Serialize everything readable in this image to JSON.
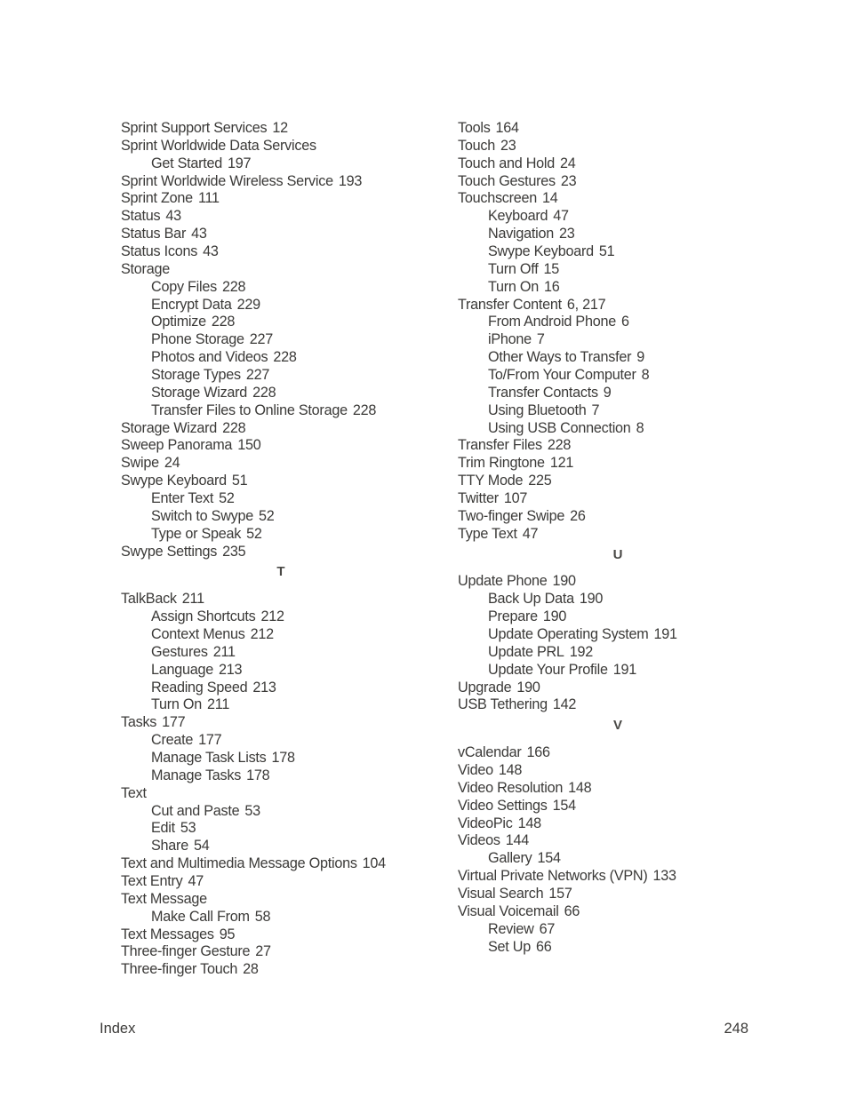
{
  "columns": [
    {
      "blocks": [
        {
          "type": "entries",
          "entries": [
            {
              "term": "Sprint Support Services",
              "pages": "12",
              "level": 0
            },
            {
              "term": "Sprint Worldwide Data Services",
              "pages": "",
              "level": 0
            },
            {
              "term": "Get Started",
              "pages": "197",
              "level": 1
            },
            {
              "term": "Sprint Worldwide Wireless Service",
              "pages": "193",
              "level": 0
            },
            {
              "term": "Sprint Zone",
              "pages": "111",
              "level": 0
            },
            {
              "term": "Status",
              "pages": "43",
              "level": 0
            },
            {
              "term": "Status Bar",
              "pages": "43",
              "level": 0
            },
            {
              "term": "Status Icons",
              "pages": "43",
              "level": 0
            },
            {
              "term": "Storage",
              "pages": "",
              "level": 0
            },
            {
              "term": "Copy Files",
              "pages": "228",
              "level": 1
            },
            {
              "term": "Encrypt Data",
              "pages": "229",
              "level": 1
            },
            {
              "term": "Optimize",
              "pages": "228",
              "level": 1
            },
            {
              "term": "Phone Storage",
              "pages": "227",
              "level": 1
            },
            {
              "term": "Photos and Videos",
              "pages": "228",
              "level": 1
            },
            {
              "term": "Storage Types",
              "pages": "227",
              "level": 1
            },
            {
              "term": "Storage Wizard",
              "pages": "228",
              "level": 1
            },
            {
              "term": "Transfer Files to Online Storage",
              "pages": "228",
              "level": 1
            },
            {
              "term": "Storage Wizard",
              "pages": "228",
              "level": 0
            },
            {
              "term": "Sweep Panorama",
              "pages": "150",
              "level": 0
            },
            {
              "term": "Swipe",
              "pages": "24",
              "level": 0
            },
            {
              "term": "Swype Keyboard",
              "pages": "51",
              "level": 0
            },
            {
              "term": "Enter Text",
              "pages": "52",
              "level": 1
            },
            {
              "term": "Switch to Swype",
              "pages": "52",
              "level": 1
            },
            {
              "term": "Type or Speak",
              "pages": "52",
              "level": 1
            },
            {
              "term": "Swype Settings",
              "pages": "235",
              "level": 0
            }
          ]
        },
        {
          "type": "letter",
          "letter": "T"
        },
        {
          "type": "entries",
          "entries": [
            {
              "term": "TalkBack",
              "pages": "211",
              "level": 0
            },
            {
              "term": "Assign Shortcuts",
              "pages": "212",
              "level": 1
            },
            {
              "term": "Context Menus",
              "pages": "212",
              "level": 1
            },
            {
              "term": "Gestures",
              "pages": "211",
              "level": 1
            },
            {
              "term": "Language",
              "pages": "213",
              "level": 1
            },
            {
              "term": "Reading Speed",
              "pages": "213",
              "level": 1
            },
            {
              "term": "Turn On",
              "pages": "211",
              "level": 1
            },
            {
              "term": "Tasks",
              "pages": "177",
              "level": 0
            },
            {
              "term": "Create",
              "pages": "177",
              "level": 1
            },
            {
              "term": "Manage Task Lists",
              "pages": "178",
              "level": 1
            },
            {
              "term": "Manage Tasks",
              "pages": "178",
              "level": 1
            },
            {
              "term": "Text",
              "pages": "",
              "level": 0
            },
            {
              "term": "Cut and Paste",
              "pages": "53",
              "level": 1
            },
            {
              "term": "Edit",
              "pages": "53",
              "level": 1
            },
            {
              "term": "Share",
              "pages": "54",
              "level": 1
            },
            {
              "term": "Text and Multimedia Message Options",
              "pages": "104",
              "level": 0
            },
            {
              "term": "Text Entry",
              "pages": "47",
              "level": 0
            },
            {
              "term": "Text Message",
              "pages": "",
              "level": 0
            },
            {
              "term": "Make Call From",
              "pages": "58",
              "level": 1
            },
            {
              "term": "Text Messages",
              "pages": "95",
              "level": 0
            },
            {
              "term": "Three-finger Gesture",
              "pages": "27",
              "level": 0
            },
            {
              "term": "Three-finger Touch",
              "pages": "28",
              "level": 0
            }
          ]
        }
      ]
    },
    {
      "blocks": [
        {
          "type": "entries",
          "entries": [
            {
              "term": "Tools",
              "pages": "164",
              "level": 0
            },
            {
              "term": "Touch",
              "pages": "23",
              "level": 0
            },
            {
              "term": "Touch and Hold",
              "pages": "24",
              "level": 0
            },
            {
              "term": "Touch Gestures",
              "pages": "23",
              "level": 0
            },
            {
              "term": "Touchscreen",
              "pages": "14",
              "level": 0
            },
            {
              "term": "Keyboard",
              "pages": "47",
              "level": 1
            },
            {
              "term": "Navigation",
              "pages": "23",
              "level": 1
            },
            {
              "term": "Swype Keyboard",
              "pages": "51",
              "level": 1
            },
            {
              "term": "Turn Off",
              "pages": "15",
              "level": 1
            },
            {
              "term": "Turn On",
              "pages": "16",
              "level": 1
            },
            {
              "term": "Transfer Content",
              "pages": "6, 217",
              "level": 0
            },
            {
              "term": "From Android Phone",
              "pages": "6",
              "level": 1
            },
            {
              "term": "iPhone",
              "pages": "7",
              "level": 1
            },
            {
              "term": "Other Ways to Transfer",
              "pages": "9",
              "level": 1
            },
            {
              "term": "To/From Your Computer",
              "pages": "8",
              "level": 1
            },
            {
              "term": "Transfer Contacts",
              "pages": "9",
              "level": 1
            },
            {
              "term": "Using Bluetooth",
              "pages": "7",
              "level": 1
            },
            {
              "term": "Using USB Connection",
              "pages": "8",
              "level": 1
            },
            {
              "term": "Transfer Files",
              "pages": "228",
              "level": 0
            },
            {
              "term": "Trim Ringtone",
              "pages": "121",
              "level": 0
            },
            {
              "term": "TTY Mode",
              "pages": "225",
              "level": 0
            },
            {
              "term": "Twitter",
              "pages": "107",
              "level": 0
            },
            {
              "term": "Two-finger Swipe",
              "pages": "26",
              "level": 0
            },
            {
              "term": "Type Text",
              "pages": "47",
              "level": 0
            }
          ]
        },
        {
          "type": "letter",
          "letter": "U"
        },
        {
          "type": "entries",
          "entries": [
            {
              "term": "Update Phone",
              "pages": "190",
              "level": 0
            },
            {
              "term": "Back Up Data",
              "pages": "190",
              "level": 1
            },
            {
              "term": "Prepare",
              "pages": "190",
              "level": 1
            },
            {
              "term": "Update Operating System",
              "pages": "191",
              "level": 1
            },
            {
              "term": "Update PRL",
              "pages": "192",
              "level": 1
            },
            {
              "term": "Update Your Profile",
              "pages": "191",
              "level": 1
            },
            {
              "term": "Upgrade",
              "pages": "190",
              "level": 0
            },
            {
              "term": "USB Tethering",
              "pages": "142",
              "level": 0
            }
          ]
        },
        {
          "type": "letter",
          "letter": "V"
        },
        {
          "type": "entries",
          "entries": [
            {
              "term": "vCalendar",
              "pages": "166",
              "level": 0
            },
            {
              "term": "Video",
              "pages": "148",
              "level": 0
            },
            {
              "term": "Video Resolution",
              "pages": "148",
              "level": 0
            },
            {
              "term": "Video Settings",
              "pages": "154",
              "level": 0
            },
            {
              "term": "VideoPic",
              "pages": "148",
              "level": 0
            },
            {
              "term": "Videos",
              "pages": "144",
              "level": 0
            },
            {
              "term": "Gallery",
              "pages": "154",
              "level": 1
            },
            {
              "term": "Virtual Private Networks (VPN)",
              "pages": "133",
              "level": 0
            },
            {
              "term": "Visual Search",
              "pages": "157",
              "level": 0
            },
            {
              "term": "Visual Voicemail",
              "pages": "66",
              "level": 0
            },
            {
              "term": "Review",
              "pages": "67",
              "level": 1
            },
            {
              "term": "Set Up",
              "pages": "66",
              "level": 1
            }
          ]
        }
      ]
    }
  ],
  "footer": {
    "section": "Index",
    "page_number": "248"
  }
}
